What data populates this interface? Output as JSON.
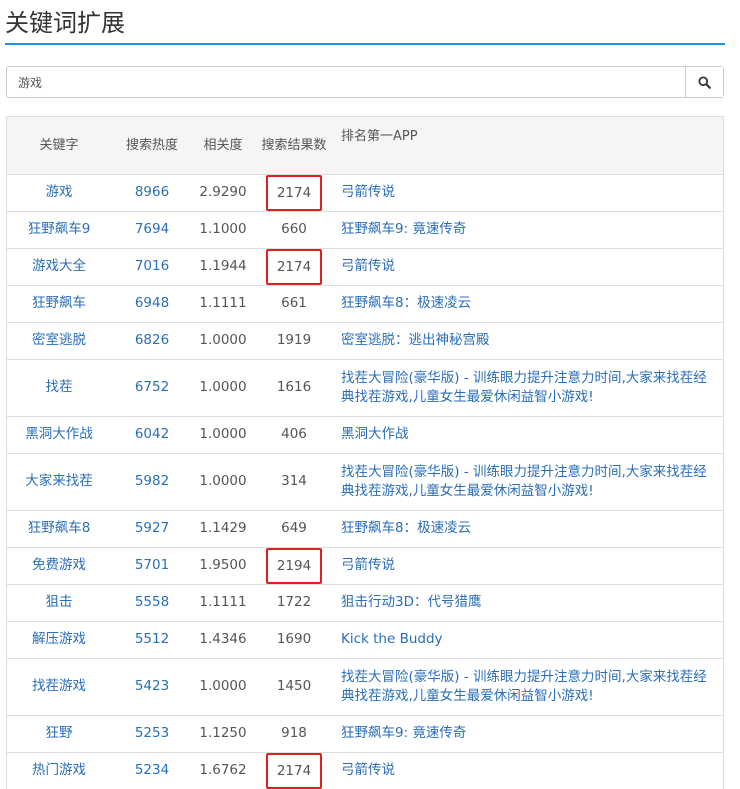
{
  "page": {
    "title": "关键词扩展"
  },
  "search": {
    "value": "游戏"
  },
  "table": {
    "headers": [
      "关键字",
      "搜索热度",
      "相关度",
      "搜索结果数",
      "排名第一APP"
    ],
    "rows": [
      {
        "keyword": "游戏",
        "heat": "8966",
        "relevance": "2.9290",
        "results": "2174",
        "app": "弓箭传说",
        "highlighted": true
      },
      {
        "keyword": "狂野飙车9",
        "heat": "7694",
        "relevance": "1.1000",
        "results": "660",
        "app": "狂野飙车9: 竟速传奇",
        "highlighted": false
      },
      {
        "keyword": "游戏大全",
        "heat": "7016",
        "relevance": "1.1944",
        "results": "2174",
        "app": "弓箭传说",
        "highlighted": true
      },
      {
        "keyword": "狂野飙车",
        "heat": "6948",
        "relevance": "1.1111",
        "results": "661",
        "app": "狂野飙车8：极速凌云",
        "highlighted": false
      },
      {
        "keyword": "密室逃脱",
        "heat": "6826",
        "relevance": "1.0000",
        "results": "1919",
        "app": "密室逃脱：逃出神秘宫殿",
        "highlighted": false
      },
      {
        "keyword": "找茬",
        "heat": "6752",
        "relevance": "1.0000",
        "results": "1616",
        "app": "找茬大冒险(豪华版) - 训练眼力提升注意力时间,大家来找茬经典找茬游戏,儿童女生最爱休闲益智小游戏!",
        "highlighted": false
      },
      {
        "keyword": "黑洞大作战",
        "heat": "6042",
        "relevance": "1.0000",
        "results": "406",
        "app": "黑洞大作战",
        "highlighted": false
      },
      {
        "keyword": "大家来找茬",
        "heat": "5982",
        "relevance": "1.0000",
        "results": "314",
        "app": "找茬大冒险(豪华版) - 训练眼力提升注意力时间,大家来找茬经典找茬游戏,儿童女生最爱休闲益智小游戏!",
        "highlighted": false
      },
      {
        "keyword": "狂野飙车8",
        "heat": "5927",
        "relevance": "1.1429",
        "results": "649",
        "app": "狂野飙车8：极速凌云",
        "highlighted": false
      },
      {
        "keyword": "免费游戏",
        "heat": "5701",
        "relevance": "1.9500",
        "results": "2194",
        "app": "弓箭传说",
        "highlighted": true
      },
      {
        "keyword": "狙击",
        "heat": "5558",
        "relevance": "1.1111",
        "results": "1722",
        "app": "狙击行动3D：代号猎鹰",
        "highlighted": false
      },
      {
        "keyword": "解压游戏",
        "heat": "5512",
        "relevance": "1.4346",
        "results": "1690",
        "app": "Kick the Buddy",
        "highlighted": false
      },
      {
        "keyword": "找茬游戏",
        "heat": "5423",
        "relevance": "1.0000",
        "results": "1450",
        "app": "找茬大冒险(豪华版) - 训练眼力提升注意力时间,大家来找茬经典找茬游戏,儿童女生最爱休闲益智小游戏!",
        "highlighted": false
      },
      {
        "keyword": "狂野",
        "heat": "5253",
        "relevance": "1.1250",
        "results": "918",
        "app": "狂野飙车9: 竟速传奇",
        "highlighted": false
      },
      {
        "keyword": "热门游戏",
        "heat": "5234",
        "relevance": "1.6762",
        "results": "2174",
        "app": "弓箭传说",
        "highlighted": true
      }
    ]
  }
}
